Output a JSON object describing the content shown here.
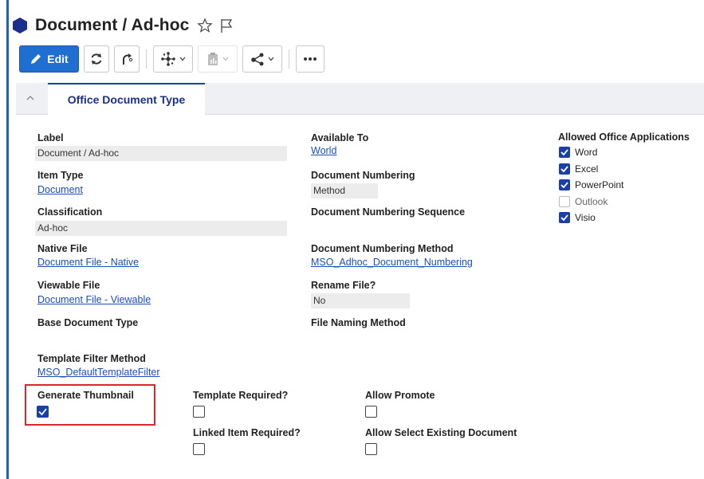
{
  "header": {
    "title": "Document / Ad-hoc"
  },
  "toolbar": {
    "edit_label": "Edit"
  },
  "section": {
    "tab_label": "Office Document Type"
  },
  "fields": {
    "label": {
      "label": "Label",
      "value": "Document / Ad-hoc"
    },
    "item_type": {
      "label": "Item Type",
      "value": "Document"
    },
    "classification": {
      "label": "Classification",
      "value": "Ad-hoc"
    },
    "native_file": {
      "label": "Native File",
      "value": "Document File - Native"
    },
    "viewable_file": {
      "label": "Viewable File",
      "value": "Document File - Viewable"
    },
    "base_doc_type": {
      "label": "Base Document Type",
      "value": ""
    },
    "template_filter": {
      "label": "Template Filter Method",
      "value": "MSO_DefaultTemplateFilter"
    },
    "available_to": {
      "label": "Available To",
      "value": "World"
    },
    "doc_numbering": {
      "label": "Document Numbering",
      "value": "Method"
    },
    "doc_numbering_seq": {
      "label": "Document Numbering Sequence",
      "value": ""
    },
    "doc_numbering_method": {
      "label": "Document Numbering Method",
      "value": "MSO_Adhoc_Document_Numbering"
    },
    "rename_file": {
      "label": "Rename File?",
      "value": "No"
    },
    "file_naming": {
      "label": "File Naming Method",
      "value": ""
    }
  },
  "office_apps": {
    "label": "Allowed Office Applications",
    "items": [
      {
        "label": "Word",
        "checked": true
      },
      {
        "label": "Excel",
        "checked": true
      },
      {
        "label": "PowerPoint",
        "checked": true
      },
      {
        "label": "Outlook",
        "checked": false
      },
      {
        "label": "Visio",
        "checked": true
      }
    ]
  },
  "flags": {
    "generate_thumbnail": {
      "label": "Generate Thumbnail",
      "checked": true
    },
    "template_required": {
      "label": "Template Required?",
      "checked": false
    },
    "linked_item_required": {
      "label": "Linked Item Required?",
      "checked": false
    },
    "allow_promote": {
      "label": "Allow Promote",
      "checked": false
    },
    "allow_select_existing": {
      "label": "Allow Select Existing Document",
      "checked": false
    }
  },
  "colors": {
    "accent": "#1b3fa8",
    "edit_button": "#1f6fd0",
    "highlight": "#d9262c",
    "link": "#1b4fb5"
  },
  "icons": [
    "hexagon-icon",
    "star-icon",
    "flag-icon",
    "pencil-icon",
    "refresh-icon",
    "promote-icon",
    "network-icon",
    "clipboard-icon",
    "share-icon",
    "more-icon",
    "chevron-up-icon"
  ]
}
